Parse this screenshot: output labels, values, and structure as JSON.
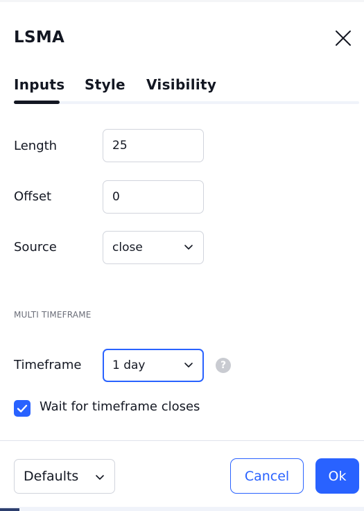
{
  "dialog": {
    "title": "LSMA",
    "close_icon": "close-icon"
  },
  "tabs": [
    {
      "label": "Inputs",
      "active": true
    },
    {
      "label": "Style",
      "active": false
    },
    {
      "label": "Visibility",
      "active": false
    }
  ],
  "inputs": {
    "length": {
      "label": "Length",
      "value": "25"
    },
    "offset": {
      "label": "Offset",
      "value": "0"
    },
    "source": {
      "label": "Source",
      "value": "close"
    }
  },
  "multi_timeframe": {
    "section_header": "MULTI TIMEFRAME",
    "timeframe": {
      "label": "Timeframe",
      "value": "1 day"
    },
    "help_icon": "question-icon",
    "wait_for_close": {
      "label": "Wait for timeframe closes",
      "checked": true
    }
  },
  "footer": {
    "defaults_label": "Defaults",
    "cancel_label": "Cancel",
    "ok_label": "Ok"
  },
  "colors": {
    "accent": "#2962ff",
    "text": "#131722",
    "border": "#d1d4dc",
    "muted": "#6a6d78"
  }
}
